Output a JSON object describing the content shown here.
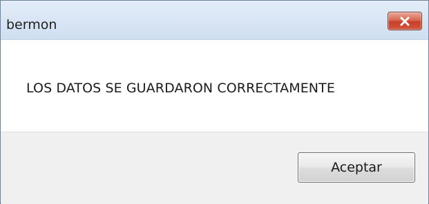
{
  "window": {
    "title": "bermon",
    "close_icon": "close-x-icon",
    "close_color": "#c94a33"
  },
  "message": {
    "text": "LOS DATOS SE GUARDARON CORRECTAMENTE"
  },
  "buttons": {
    "ok_label": "Aceptar"
  }
}
